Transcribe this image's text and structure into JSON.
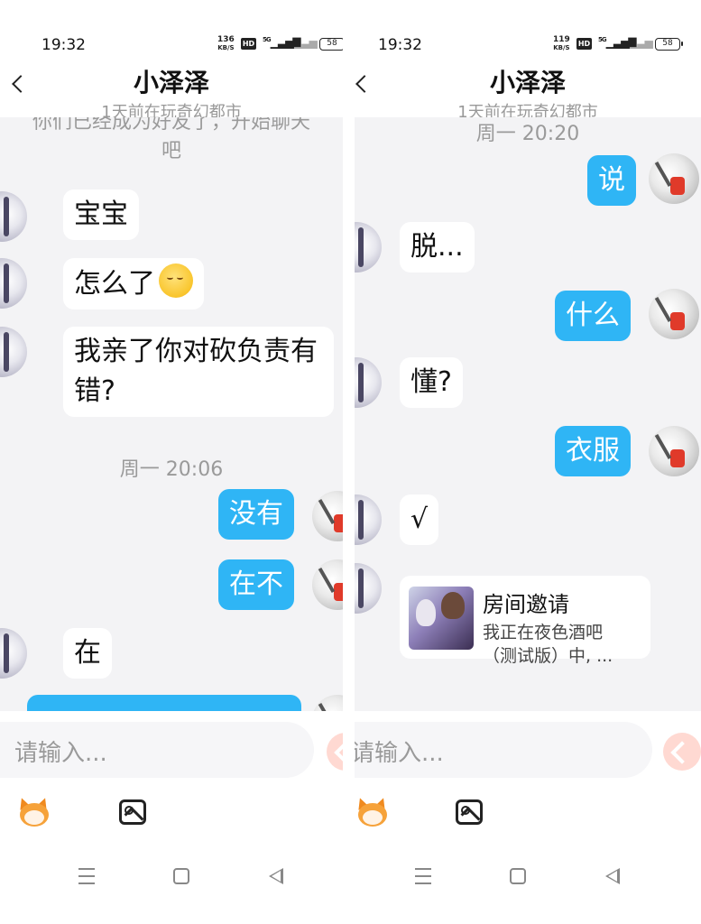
{
  "status": {
    "time": "19:32",
    "left_speed": "136",
    "right_speed": "119",
    "speed_unit": "KB/S",
    "hd": "HD",
    "network": "5G",
    "battery": "58"
  },
  "header": {
    "title": "小泽泽",
    "subtitle": "1天前在玩奇幻都市"
  },
  "left_chat": {
    "system_msg": "你们已经成为好友了，开始聊天吧",
    "messages": [
      {
        "side": "in",
        "text": "宝宝"
      },
      {
        "side": "in",
        "text": "怎么了",
        "emoji": "yawning-face-icon"
      },
      {
        "side": "in",
        "text": "我亲了你对砍负责有错?"
      },
      {
        "side": "out",
        "text": "没有"
      },
      {
        "side": "out",
        "text": "在不"
      },
      {
        "side": "in",
        "text": "在"
      }
    ],
    "timestamp": "周一 20:06"
  },
  "right_chat": {
    "timestamp": "周一 20:20",
    "messages": [
      {
        "side": "out",
        "text": "说"
      },
      {
        "side": "in",
        "text": "脱..."
      },
      {
        "side": "out",
        "text": "什么"
      },
      {
        "side": "in",
        "text": "懂?"
      },
      {
        "side": "out",
        "text": "衣服"
      },
      {
        "side": "in",
        "text": "√"
      }
    ],
    "invite": {
      "title": "房间邀请",
      "desc": "我正在夜色酒吧（测试版）中, ..."
    }
  },
  "input": {
    "placeholder": "请输入..."
  },
  "colors": {
    "outgoing_bubble": "#2fb5f5",
    "chat_background": "#f3f3f5",
    "send_button": "#ffd9d2"
  }
}
